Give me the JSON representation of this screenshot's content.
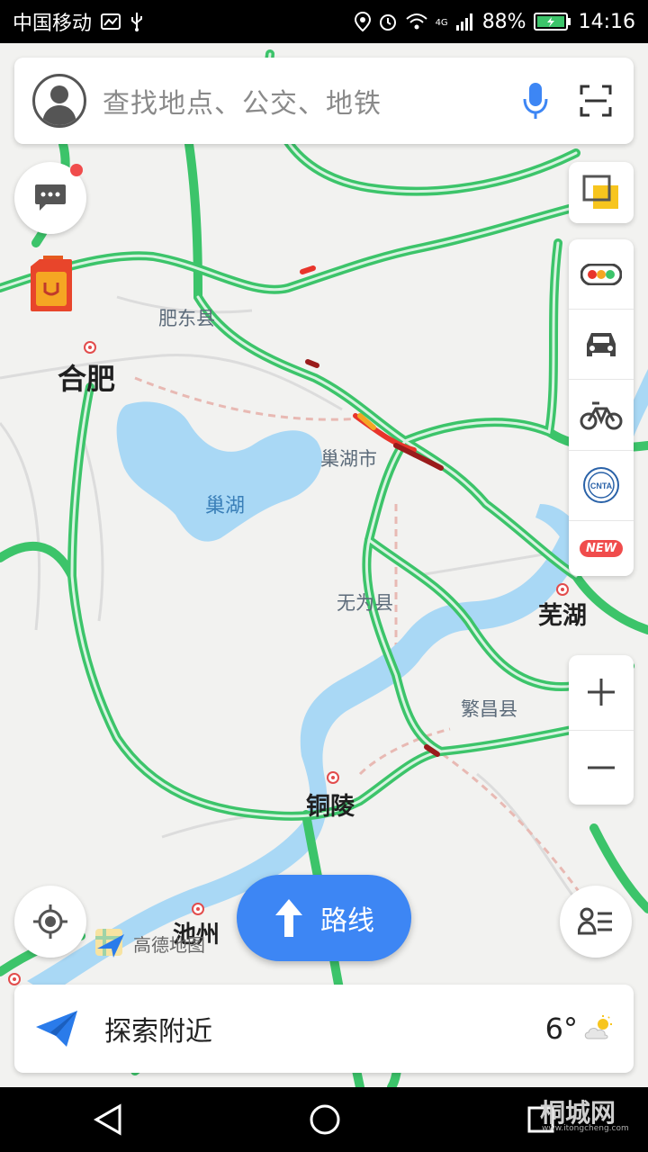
{
  "status_bar": {
    "carrier": "中国移动",
    "network": "4G",
    "battery": "88%",
    "time": "14:16"
  },
  "search": {
    "placeholder": "查找地点、公交、地铁"
  },
  "map": {
    "labels": {
      "hefei": "合肥",
      "feidong": "肥东县",
      "chaohu_lake": "巢湖",
      "chaohu_city": "巢湖市",
      "wuwei": "无为县",
      "wuhu": "芜湖",
      "fanchang": "繁昌县",
      "tongling": "铜陵",
      "chizhou": "池州"
    },
    "attribution": "高德地图"
  },
  "side_toolbar": {
    "new_badge": "NEW",
    "cnta_label": "CNTA"
  },
  "route_button": {
    "label": "路线"
  },
  "explore": {
    "title": "探索附近",
    "temperature": "6°"
  },
  "watermark": {
    "text": "桐城网",
    "url": "www.itongcheng.com"
  },
  "colors": {
    "road_green": "#3cc46a",
    "water": "#a9d8f5",
    "accent_blue": "#3d86f4"
  }
}
